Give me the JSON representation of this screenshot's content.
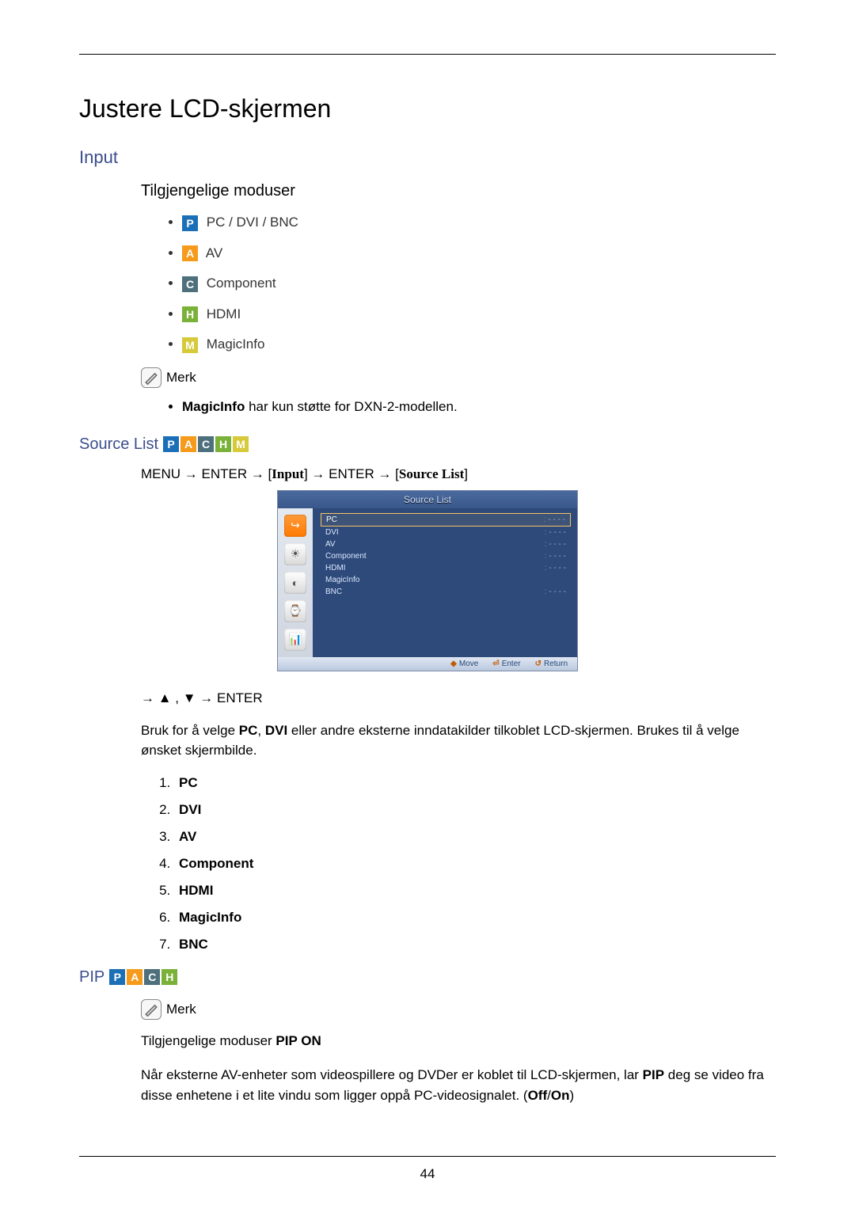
{
  "page_title": "Justere LCD-skjermen",
  "input_heading": "Input",
  "modes_heading": "Tilgjengelige moduser",
  "modes": [
    {
      "letter": "P",
      "cls": "badge-p",
      "label": "PC / DVI / BNC"
    },
    {
      "letter": "A",
      "cls": "badge-a",
      "label": "AV"
    },
    {
      "letter": "C",
      "cls": "badge-c",
      "label": "Component"
    },
    {
      "letter": "H",
      "cls": "badge-h",
      "label": "HDMI"
    },
    {
      "letter": "M",
      "cls": "badge-m",
      "label": "MagicInfo"
    }
  ],
  "note_label": "Merk",
  "note_bullet_bold": "MagicInfo",
  "note_bullet_rest": " har kun støtte for DXN-2-modellen.",
  "source_list_heading": "Source List",
  "menu_path": {
    "p1": "MENU → ENTER → [",
    "p2": "Input",
    "p3": "] → ENTER → [",
    "p4": "Source List",
    "p5": "]"
  },
  "osd": {
    "title": "Source List",
    "rows": [
      {
        "name": "PC",
        "val": "- - - -",
        "sel": true
      },
      {
        "name": "DVI",
        "val": "- - - -",
        "sel": false
      },
      {
        "name": "AV",
        "val": "- - - -",
        "sel": false
      },
      {
        "name": "Component",
        "val": "- - - -",
        "sel": false
      },
      {
        "name": "HDMI",
        "val": "- - - -",
        "sel": false
      },
      {
        "name": "MagicInfo",
        "val": "",
        "sel": false
      },
      {
        "name": "BNC",
        "val": "- - - -",
        "sel": false
      }
    ],
    "bottom": [
      {
        "sym": "◆",
        "label": "Move"
      },
      {
        "sym": "⏎",
        "label": "Enter"
      },
      {
        "sym": "↺",
        "label": "Return"
      }
    ]
  },
  "post_nav": "→ ▲ , ▼ → ENTER",
  "source_body_prefix": "Bruk for å velge ",
  "source_body_pc": "PC",
  "source_body_comma": ", ",
  "source_body_dvi": "DVI",
  "source_body_rest": " eller andre eksterne inndatakilder tilkoblet LCD-skjermen. Brukes til å velge ønsket skjermbilde.",
  "num_list": [
    "PC",
    "DVI",
    "AV",
    "Component",
    "HDMI",
    "MagicInfo",
    "BNC"
  ],
  "pip_heading": "PIP",
  "pip_modes_prefix": "Tilgjengelige moduser ",
  "pip_modes_bold": "PIP ON",
  "pip_body_p1": "Når eksterne AV-enheter som videospillere og DVDer er koblet til LCD-skjermen, lar ",
  "pip_body_b1": "PIP",
  "pip_body_p2": " deg se video fra disse enhetene i et lite vindu som ligger oppå PC-videosignalet. (",
  "pip_body_b2": "Off",
  "pip_body_slash": "/",
  "pip_body_b3": "On",
  "pip_body_p3": ")",
  "page_number": "44"
}
